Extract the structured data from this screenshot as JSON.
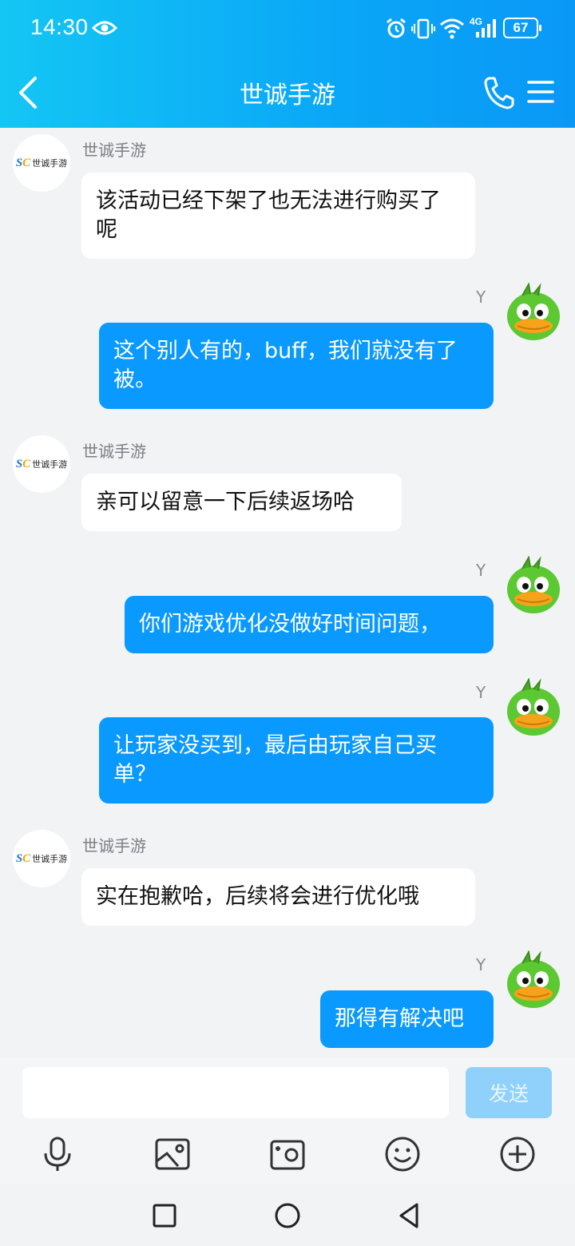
{
  "status_bar": {
    "time": "14:30",
    "network": "4G",
    "battery": "67"
  },
  "header": {
    "title": "世诚手游"
  },
  "messages": [
    {
      "side": "left",
      "sender": "世诚手游",
      "text": "该活动已经下架了也无法进行购买了呢"
    },
    {
      "side": "right",
      "sender": "Y",
      "text": "这个别人有的，buff，我们就没有了被。"
    },
    {
      "side": "left",
      "sender": "世诚手游",
      "text": "亲可以留意一下后续返场哈"
    },
    {
      "side": "right",
      "sender": "Y",
      "text": "你们游戏优化没做好时间问题，"
    },
    {
      "side": "right",
      "sender": "Y",
      "text": "让玩家没买到，最后由玩家自己买单？"
    },
    {
      "side": "left",
      "sender": "世诚手游",
      "text": "实在抱歉哈，后续将会进行优化哦"
    },
    {
      "side": "right",
      "sender": "Y",
      "text": "那得有解决吧"
    }
  ],
  "avatar_logo": {
    "mark_s": "S",
    "mark_c": "C",
    "text": "世诚手游"
  },
  "input": {
    "value": "",
    "placeholder": "",
    "send_label": "发送"
  },
  "toolbar": {
    "icons": [
      "microphone-icon",
      "image-icon",
      "camera-icon",
      "emoji-icon",
      "plus-circle-icon"
    ]
  },
  "colors": {
    "header_gradient_start": "#14c6f4",
    "header_gradient_end": "#0a98f7",
    "bubble_self": "#0a99ff",
    "bubble_other": "#ffffff",
    "send_disabled": "#8fd1fb",
    "background": "#f2f3f5"
  }
}
